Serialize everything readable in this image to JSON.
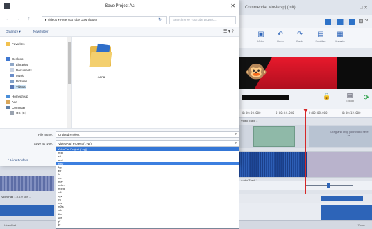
{
  "dialog": {
    "title": "Save Project As",
    "close_glyph": "✕",
    "nav": {
      "back_glyph": "←",
      "forward_glyph": "→",
      "up_glyph": "↑",
      "address": "▸ Videos ▸ Free YouTube Downloader",
      "refresh_glyph": "↻",
      "search_placeholder": "Search Free YouTube Downlo..."
    },
    "commands": {
      "organize": "Organize ▾",
      "new_folder": "New folder",
      "view_glyphs": "☰ ▾  ?"
    },
    "tree": [
      {
        "label": "Favorites",
        "icon": "star",
        "selected": false
      },
      {
        "label": "Desktop",
        "icon": "desk",
        "selected": false
      },
      {
        "label": "Libraries",
        "icon": "lib",
        "selected": false
      },
      {
        "label": "Documents",
        "icon": "doc",
        "selected": false
      },
      {
        "label": "Music",
        "icon": "mus",
        "selected": false
      },
      {
        "label": "Pictures",
        "icon": "pic",
        "selected": false
      },
      {
        "label": "Videos",
        "icon": "vid",
        "selected": true
      },
      {
        "label": "Homegroup",
        "icon": "home",
        "selected": false
      },
      {
        "label": "Ann",
        "icon": "user",
        "selected": false
      },
      {
        "label": "Computer",
        "icon": "comp",
        "selected": false
      },
      {
        "label": "OS (C:)",
        "icon": "disk",
        "selected": false
      }
    ],
    "files": [
      {
        "name": "Anna"
      }
    ],
    "file_name_label": "File name:",
    "file_name_value": "Untitled Project",
    "save_type_label": "Save as type:",
    "save_type_value": "VideoPad Project (*.vpj)",
    "hide_folders": "⌃ Hide Folders",
    "chevron_glyph": "▾"
  },
  "type_dropdown": {
    "items": [
      {
        "label": "VideoPad Project (*.vpj)",
        "state": "selected"
      },
      {
        "label": "mpg",
        "state": ""
      },
      {
        "label": "avi",
        "state": ""
      },
      {
        "label": "mp4",
        "state": ""
      },
      {
        "label": "wmv",
        "state": "highlighted"
      },
      {
        "label": "3gp",
        "state": ""
      },
      {
        "label": "asf",
        "state": ""
      },
      {
        "label": "flv",
        "state": ""
      },
      {
        "label": "mkv",
        "state": ""
      },
      {
        "label": "mov",
        "state": ""
      },
      {
        "label": "webm",
        "state": ""
      },
      {
        "label": "mpeg",
        "state": ""
      },
      {
        "label": "m4v",
        "state": ""
      },
      {
        "label": "ogv",
        "state": ""
      },
      {
        "label": "rm",
        "state": ""
      },
      {
        "label": "mts",
        "state": ""
      },
      {
        "label": "m2ts",
        "state": ""
      },
      {
        "label": "vob",
        "state": ""
      },
      {
        "label": "divx",
        "state": ""
      },
      {
        "label": "swf",
        "state": ""
      },
      {
        "label": "gif",
        "state": ""
      },
      {
        "label": "dv",
        "state": ""
      }
    ]
  },
  "app": {
    "title": "Commercial Movie.vpj (mit)",
    "window_buttons": "– □ ✕",
    "menu_icons": "⊞ ?",
    "toolbar": [
      {
        "label": "Video",
        "glyph": "▣"
      },
      {
        "label": "Undo",
        "glyph": "↶"
      },
      {
        "label": "Redo",
        "glyph": "↷"
      },
      {
        "label": "Subtitles",
        "glyph": "▤"
      },
      {
        "label": "Narrate",
        "glyph": "▦"
      }
    ],
    "lock_glyph": "🔒",
    "export_label": "Export",
    "export_glyph": "▤",
    "go_glyph": "⟳",
    "mascot_glyph": "🐵",
    "ruler": [
      "0:00:00.000",
      "0:00:04.000",
      "0:00:08.000",
      "0:00:12.000"
    ],
    "video_track_label": "Video Track 1",
    "drop_hint": "Drag and drop your video here, or...",
    "audio_track_label": "Audio Track 1",
    "left_track_label": "VideoPad 1.0.0.0 Nch ...",
    "status_left": "VideoPad",
    "status_right": "Zoom ..."
  }
}
